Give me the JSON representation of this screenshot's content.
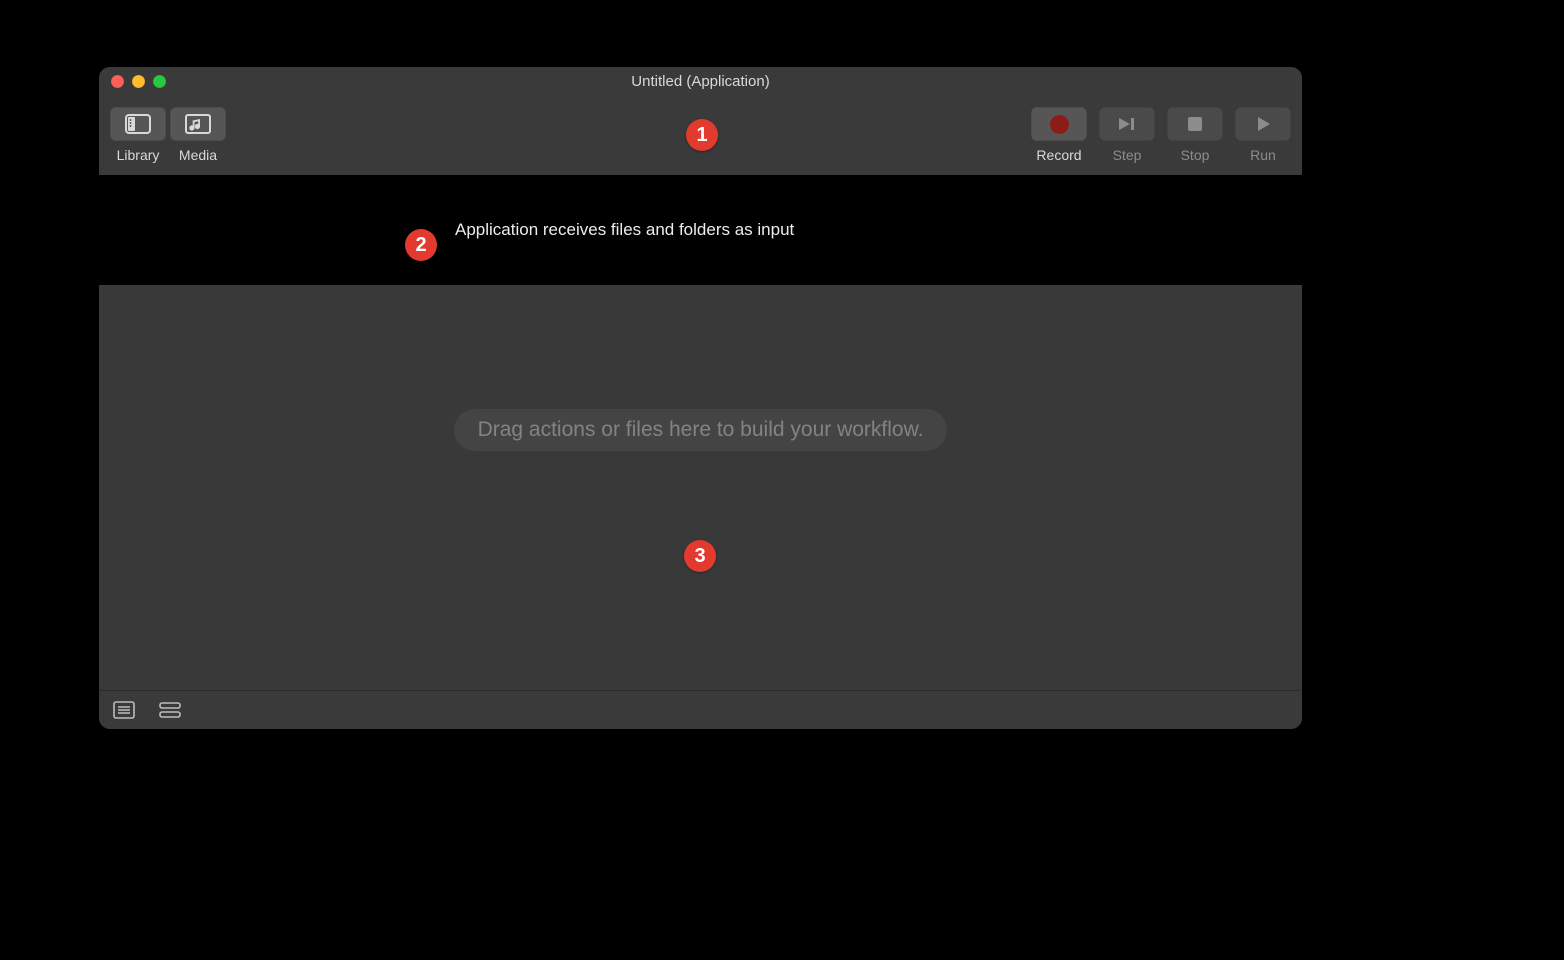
{
  "window": {
    "title": "Untitled (Application)"
  },
  "toolbar": {
    "library_label": "Library",
    "media_label": "Media",
    "record_label": "Record",
    "step_label": "Step",
    "stop_label": "Stop",
    "run_label": "Run"
  },
  "workflow": {
    "input_description": "Application receives files and folders as input",
    "drop_hint": "Drag actions or files here to build your workflow."
  },
  "annotations": {
    "badge1": "1",
    "badge2": "2",
    "badge3": "3"
  }
}
